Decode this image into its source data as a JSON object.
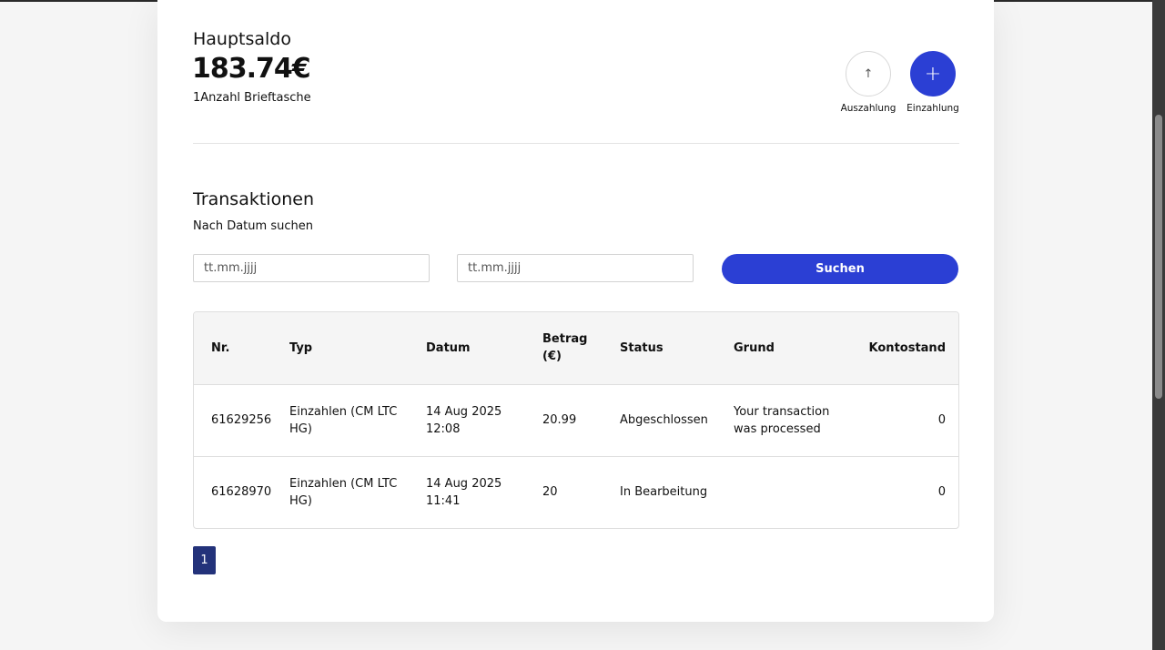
{
  "balance": {
    "label": "Hauptsaldo",
    "value": "183.74€",
    "wallet_count": "1Anzahl Brieftasche"
  },
  "actions": {
    "withdraw": {
      "icon": "arrow-up-icon",
      "glyph": "↑",
      "label": "Auszahlung"
    },
    "deposit": {
      "icon": "plus-icon",
      "glyph": "+",
      "label": "Einzahlung"
    }
  },
  "transactions": {
    "title": "Transaktionen",
    "subtitle": "Nach Datum suchen",
    "date_from_placeholder": "tt.mm.jjjj",
    "date_to_placeholder": "tt.mm.jjjj",
    "search_label": "Suchen"
  },
  "table": {
    "headers": [
      "Nr.",
      "Typ",
      "Datum",
      "Betrag (€)",
      "Status",
      "Grund",
      "Kontostand"
    ],
    "rows": [
      [
        "61629256",
        "Einzahlen (CM LTC HG)",
        "14 Aug 2025 12:08",
        "20.99",
        "Abgeschlossen",
        "Your transaction was processed",
        "0"
      ],
      [
        "61628970",
        "Einzahlen (CM LTC HG)",
        "14 Aug 2025 11:41",
        "20",
        "In Bearbeitung",
        "",
        "0"
      ]
    ]
  },
  "pagination": {
    "current": "1"
  },
  "colors": {
    "primary": "#2b3fd4",
    "page_active": "#23327a"
  }
}
